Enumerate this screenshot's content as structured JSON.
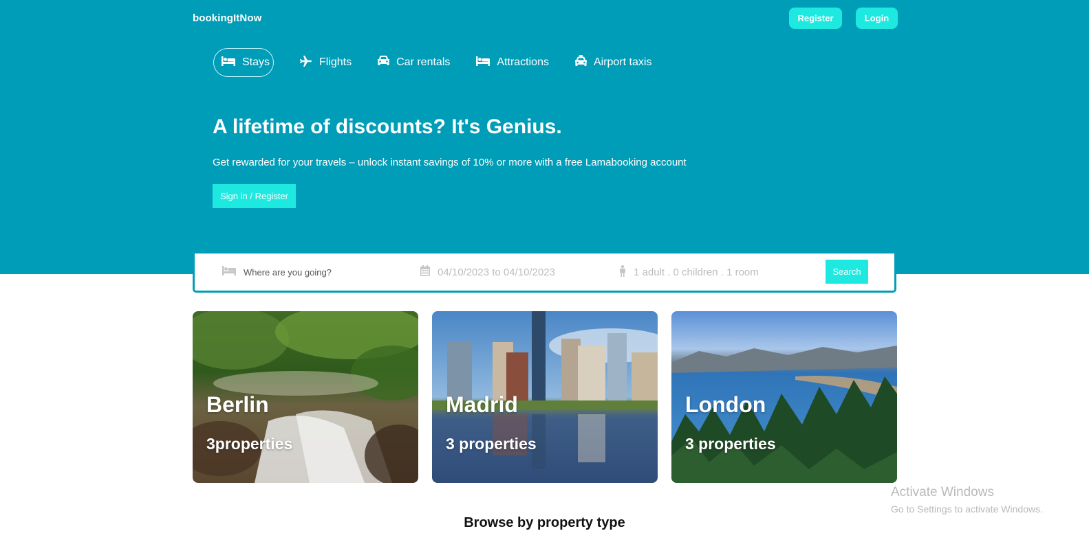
{
  "header": {
    "logo": "bookingItNow",
    "register_label": "Register",
    "login_label": "Login"
  },
  "tabs": [
    {
      "label": "Stays",
      "icon": "bed-icon",
      "active": true
    },
    {
      "label": "Flights",
      "icon": "plane-icon",
      "active": false
    },
    {
      "label": "Car rentals",
      "icon": "car-icon",
      "active": false
    },
    {
      "label": "Attractions",
      "icon": "bed-icon",
      "active": false
    },
    {
      "label": "Airport taxis",
      "icon": "taxi-icon",
      "active": false
    }
  ],
  "hero": {
    "title": "A lifetime of discounts? It's Genius.",
    "description": "Get rewarded for your travels – unlock instant savings of 10% or more with a free Lamabooking account",
    "cta_label": "Sign in / Register"
  },
  "search": {
    "destination_placeholder": "Where are you going?",
    "date_range": "04/10/2023 to 04/10/2023",
    "guests": "1 adult . 0 children . 1 room",
    "button_label": "Search"
  },
  "featured": [
    {
      "city": "Berlin",
      "properties": "3properties"
    },
    {
      "city": "Madrid",
      "properties": "3 properties"
    },
    {
      "city": "London",
      "properties": "3 properties"
    }
  ],
  "browse_title": "Browse by property type",
  "watermark": {
    "line1": "Activate Windows",
    "line2": "Go to Settings to activate Windows."
  },
  "colors": {
    "brand": "#009db8",
    "accent": "#1de9e0"
  }
}
